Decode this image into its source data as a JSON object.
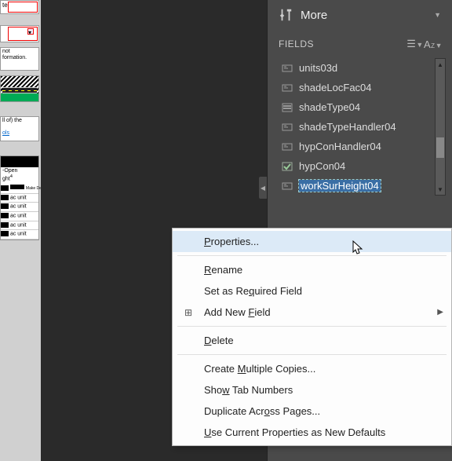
{
  "panel": {
    "more_label": "More",
    "section_label": "FIELDS",
    "fields": [
      {
        "name": "units03d",
        "type": "text",
        "selected": false
      },
      {
        "name": "shadeLocFac04",
        "type": "text",
        "selected": false
      },
      {
        "name": "shadeType04",
        "type": "dropdown",
        "selected": false
      },
      {
        "name": "shadeTypeHandler04",
        "type": "text",
        "selected": false
      },
      {
        "name": "hypConHandler04",
        "type": "text",
        "selected": false
      },
      {
        "name": "hypCon04",
        "type": "checkbox",
        "selected": false
      },
      {
        "name": "workSurHeight04",
        "type": "text",
        "selected": true
      }
    ]
  },
  "context_menu": {
    "items": [
      {
        "label_pre": "",
        "mnemonic": "P",
        "label_post": "roperties...",
        "highlight": true
      },
      {
        "separator": true
      },
      {
        "label_pre": "",
        "mnemonic": "R",
        "label_post": "ename"
      },
      {
        "label_pre": "Set as Re",
        "mnemonic": "q",
        "label_post": "uired Field"
      },
      {
        "label_pre": "Add New ",
        "mnemonic": "F",
        "label_post": "ield",
        "icon": "add-field",
        "submenu": true
      },
      {
        "separator": true
      },
      {
        "label_pre": "",
        "mnemonic": "D",
        "label_post": "elete"
      },
      {
        "separator": true
      },
      {
        "label_pre": "Create ",
        "mnemonic": "M",
        "label_post": "ultiple Copies..."
      },
      {
        "label_pre": "Sho",
        "mnemonic": "w",
        "label_post": " Tab Numbers"
      },
      {
        "label_pre": "Duplicate Acr",
        "mnemonic": "o",
        "label_post": "ss Pages..."
      },
      {
        "label_pre": "",
        "mnemonic": "U",
        "label_post": "se Current Properties as New Defaults"
      }
    ]
  },
  "left_preview": {
    "frag1_text": "te",
    "frag2_note1": "not",
    "frag2_note2": "formation.",
    "frag3_text": "ll of) the",
    "frag3_link": "ols",
    "list_hdr1": "-Open",
    "list_hdr2": "ght",
    "make_default": "Make\nDefault",
    "ac_unit": "ac unit"
  }
}
